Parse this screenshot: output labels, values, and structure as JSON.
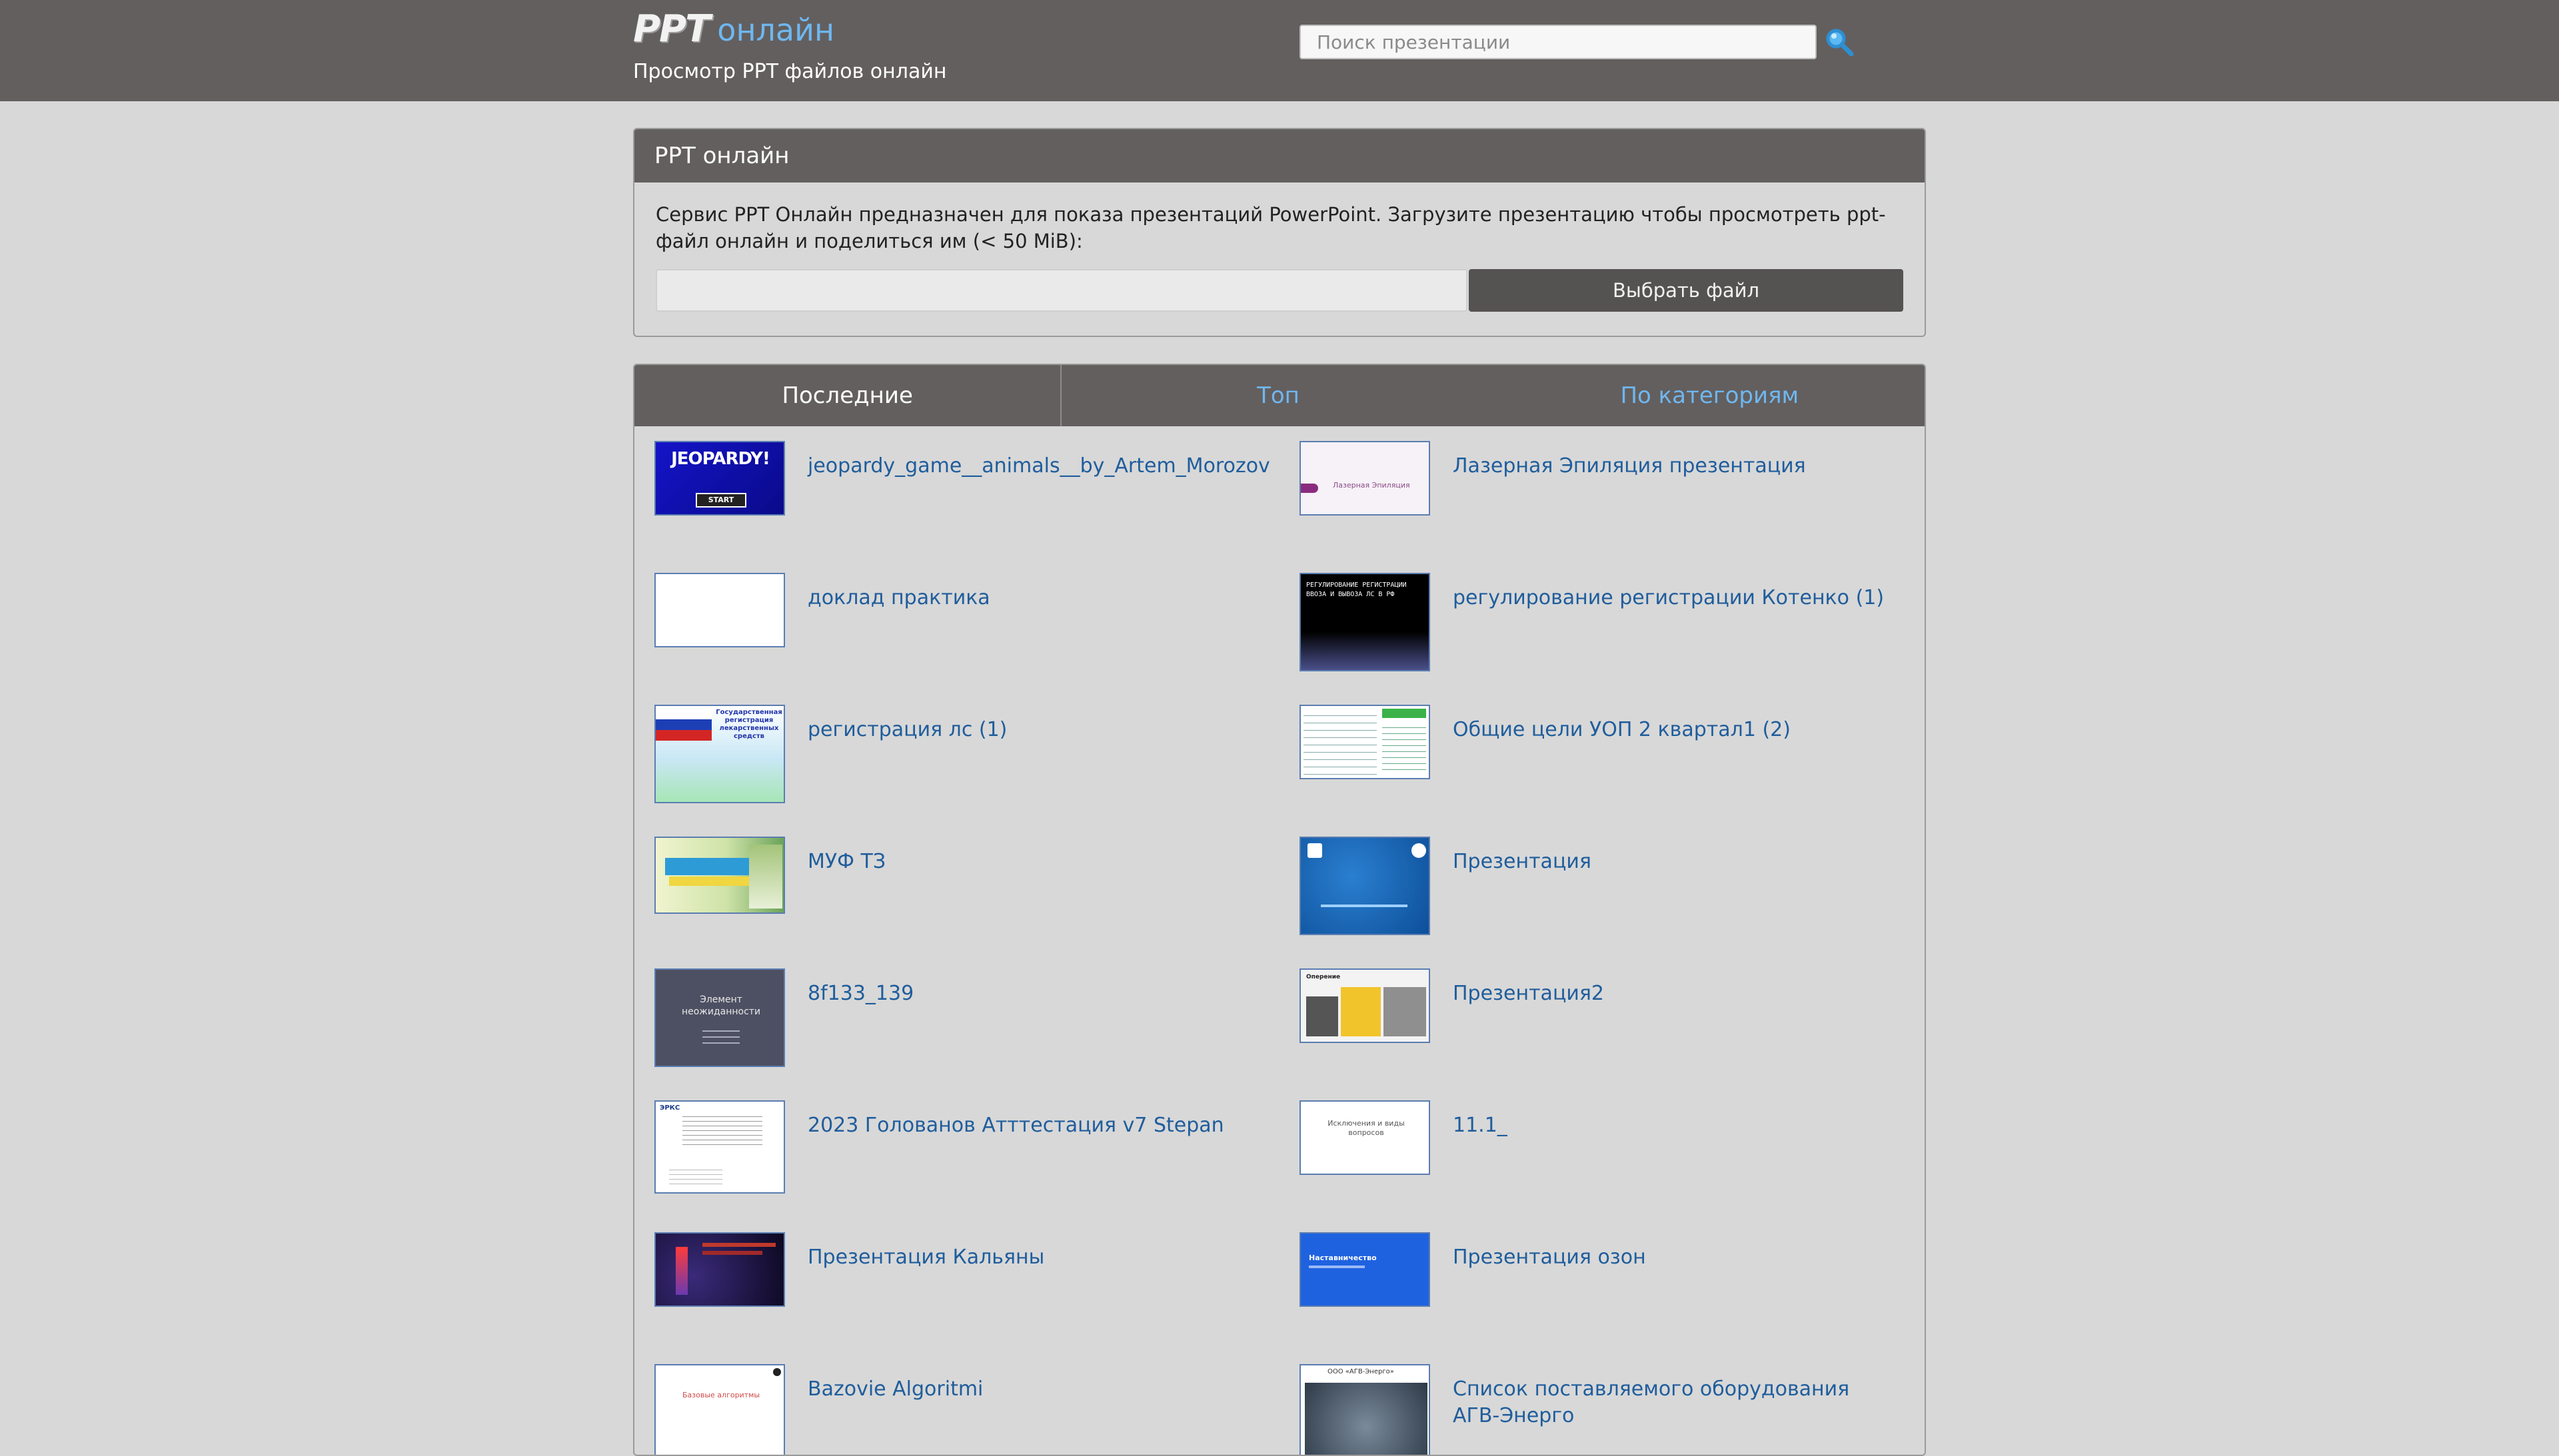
{
  "header": {
    "logo_mark": "PPT",
    "logo_word": "онлайн",
    "tagline": "Просмотр PPT файлов онлайн",
    "search_placeholder": "Поиск презентации",
    "search_icon": "search-icon"
  },
  "upload": {
    "title": "PPT онлайн",
    "description": "Сервис PPT Онлайн предназначен для показа презентаций PowerPoint. Загрузите презентацию чтобы просмотреть ppt-файл онлайн и поделиться им (< 50 MiB):",
    "button": "Выбрать файл"
  },
  "tabs": [
    {
      "label": "Последние"
    },
    {
      "label": "Топ"
    },
    {
      "label": "По категориям"
    }
  ],
  "presentations": [
    {
      "title": "jeopardy_game__animals__by_Artem_Morozov",
      "thumb_text": "JEOPARDY!",
      "thumb_sub": "START"
    },
    {
      "title": "Лазерная Эпиляция презентация",
      "thumb_text": "Лазерная Эпиляция"
    },
    {
      "title": "доклад практика"
    },
    {
      "title": "регулирование регистрации Котенко (1)",
      "thumb_text": "РЕГУЛИРОВАНИЕ РЕГИСТРАЦИИ ВВОЗА И ВЫВОЗА ЛС В РФ"
    },
    {
      "title": "регистрация лс (1)",
      "thumb_text": "Государственная регистрация лекарственных средств"
    },
    {
      "title": "Общие цели УОП 2 квартал1 (2)"
    },
    {
      "title": "МУФ ТЗ"
    },
    {
      "title": "Презентация"
    },
    {
      "title": "8f133_139",
      "thumb_text": "Элемент неожиданности"
    },
    {
      "title": "Презентация2",
      "thumb_text": "Оперение"
    },
    {
      "title": "2023 Голованов Атттестация v7 Stepan",
      "thumb_text": "ЭРКС"
    },
    {
      "title": "11.1_",
      "thumb_text": "Исключения и виды вопросов"
    },
    {
      "title": "Презентация Кальяны"
    },
    {
      "title": "Презентация озон",
      "thumb_text": "Наставничество"
    },
    {
      "title": "Bazovie Algoritmi",
      "thumb_text": "Базовые алгоритмы"
    },
    {
      "title": "Список поставляемого оборудования АГВ-Энерго",
      "thumb_text": "ООО «АГВ-Энерго»"
    }
  ]
}
